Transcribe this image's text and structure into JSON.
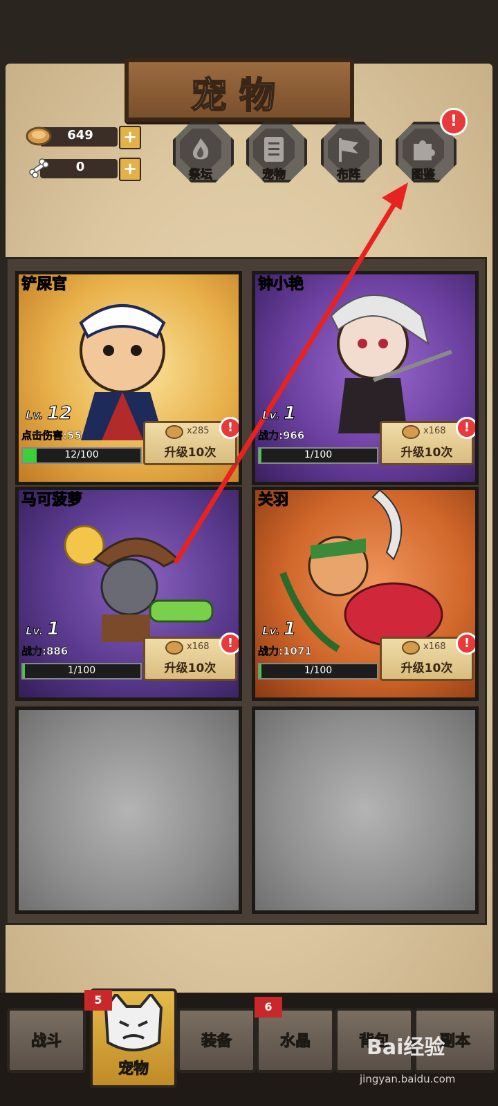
{
  "header": {
    "title": "宠物"
  },
  "currencies": [
    {
      "icon": "cookie-icon",
      "value": "649"
    },
    {
      "icon": "bone-icon",
      "value": "0"
    }
  ],
  "menu": [
    {
      "label": "祭坛",
      "icon": "altar-flame-icon"
    },
    {
      "label": "宠物",
      "icon": "pet-list-icon"
    },
    {
      "label": "布阵",
      "icon": "formation-flag-icon"
    },
    {
      "label": "图鉴",
      "icon": "puzzle-icon",
      "alert": "!"
    }
  ],
  "pets": [
    {
      "name": "铲屎官",
      "level_prefix": "Lv.",
      "level": "12",
      "stat": "点击伤害:55",
      "progress_text": "12/100",
      "progress": 0.12,
      "cost": "x285",
      "upgrade": "升级10次",
      "color": "#e8b04a",
      "alert": "!"
    },
    {
      "name": "钟小艳",
      "level_prefix": "Lv.",
      "level": "1",
      "stat": "战力:966",
      "progress_text": "1/100",
      "progress": 0.01,
      "cost": "x168",
      "upgrade": "升级10次",
      "color": "#6a3f9e",
      "alert": "!"
    },
    {
      "name": "马可菠萝",
      "level_prefix": "Lv.",
      "level": "1",
      "stat": "战力:886",
      "progress_text": "1/100",
      "progress": 0.01,
      "cost": "x168",
      "upgrade": "升级10次",
      "color": "#5a3a8e",
      "alert": "!"
    },
    {
      "name": "关羽",
      "level_prefix": "Lv.",
      "level": "1",
      "stat": "战力:1071",
      "progress_text": "1/100",
      "progress": 0.01,
      "cost": "x168",
      "upgrade": "升级10次",
      "color": "#d0662a",
      "alert": "!"
    }
  ],
  "tabs": [
    {
      "label": "战斗"
    },
    {
      "label": "宠物",
      "badge": "5",
      "active": true
    },
    {
      "label": "装备"
    },
    {
      "label": "水晶",
      "badge": "6"
    },
    {
      "label": "背包"
    },
    {
      "label": "副本"
    }
  ],
  "watermark": {
    "logo": "Bai经验",
    "url": "jingyan.baidu.com"
  },
  "colors": {
    "arrow": "#e8231f",
    "alert": "#e83a3a",
    "gold": "#e2b248"
  }
}
